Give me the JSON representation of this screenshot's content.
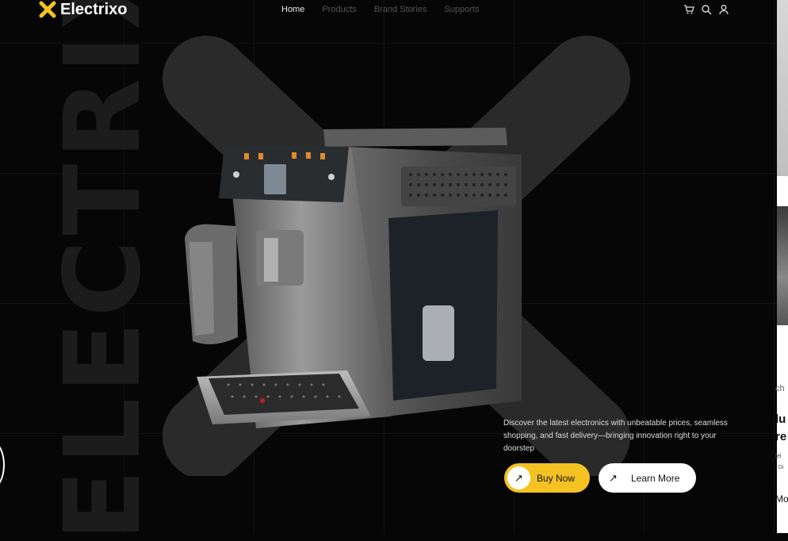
{
  "brand": {
    "name": "Electrixo",
    "watermark": "ELECTRIXO",
    "accent": "#f4c223"
  },
  "nav": {
    "items": [
      {
        "label": "Home",
        "active": true
      },
      {
        "label": "Products",
        "active": false
      },
      {
        "label": "Brand Stories",
        "active": false
      },
      {
        "label": "Supports",
        "active": false
      }
    ],
    "icons": [
      "cart-icon",
      "search-icon",
      "user-icon"
    ]
  },
  "hero": {
    "description": "Discover the latest electronics with unbeatable prices, seamless shopping, and fast delivery—bringing innovation right to your doorstep",
    "buy_label": "Buy Now",
    "learn_label": "Learn More"
  },
  "side_card": {
    "lines": [
      "ch",
      "lu",
      "re",
      "tel",
      ". Di",
      "Mo"
    ]
  }
}
